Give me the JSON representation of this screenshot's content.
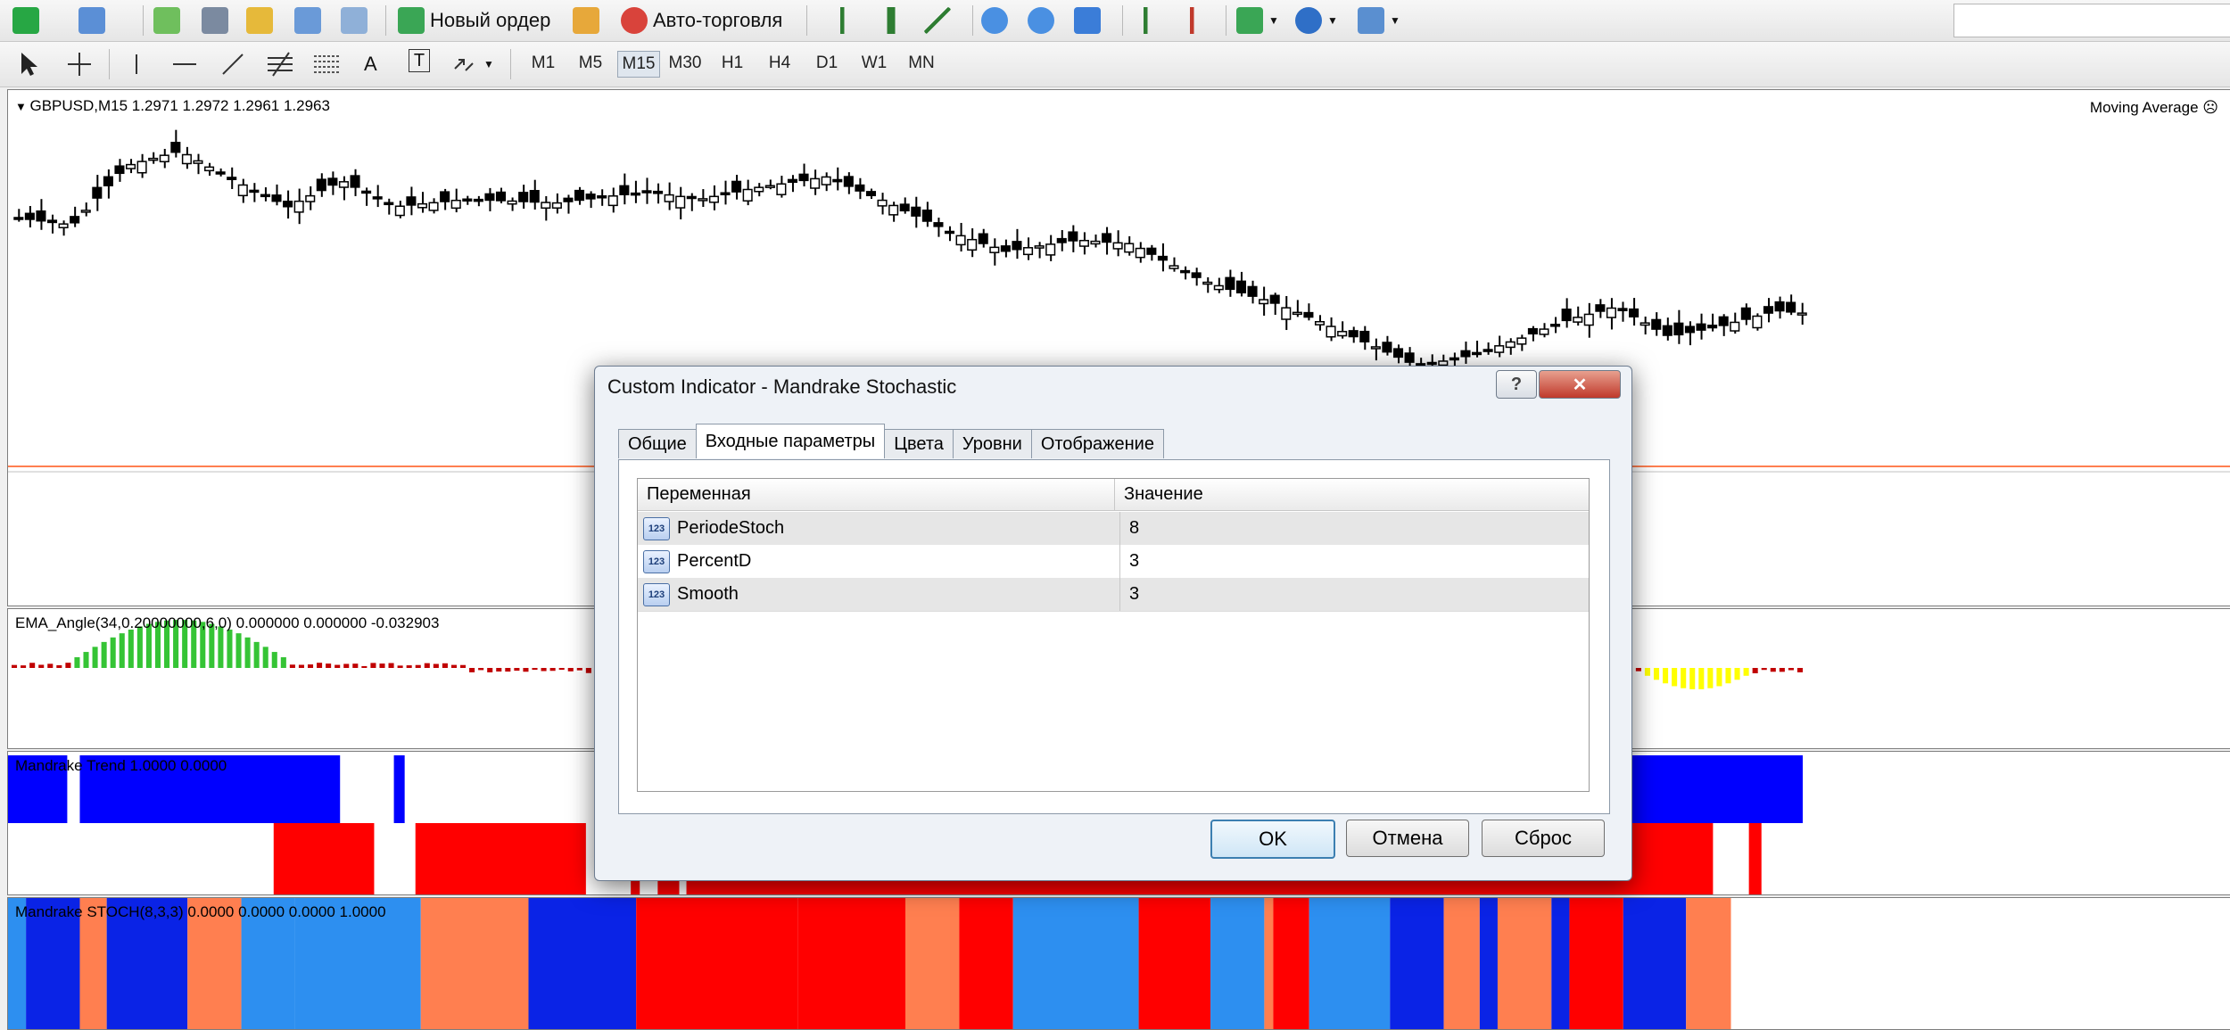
{
  "toolbar": {
    "new_order": "Новый ордер",
    "auto_trading": "Авто-торговля",
    "timeframes": [
      "M1",
      "M5",
      "M15",
      "M30",
      "H1",
      "H4",
      "D1",
      "W1",
      "MN"
    ],
    "active_timeframe": "M15",
    "draw_tools": [
      "cursor-icon",
      "crosshair-icon",
      "vertical-line-icon",
      "horizontal-line-icon",
      "trendline-icon",
      "fibonacci-icon",
      "fibo-fan-icon",
      "text-icon",
      "text-label-icon",
      "arrows-icon"
    ],
    "text_tool_label": "A",
    "text_label_tool": "T"
  },
  "main_chart": {
    "symbol_info": "GBPUSD,M15  1.2971 1.2972 1.2961 1.2963",
    "expert_label": "Moving Average"
  },
  "ema_pane": {
    "label": "EMA_Angle(34,0.20000000,6,0) 0.000000 0.000000 -0.032903"
  },
  "trend_pane": {
    "label": "Mandrake Trend 1.0000 0.0000"
  },
  "stoch_pane": {
    "label": "Mandrake STOCH(8,3,3) 0.0000 0.0000 0.0000 1.0000"
  },
  "dialog": {
    "title": "Custom Indicator - Mandrake Stochastic",
    "help_symbol": "?",
    "close_symbol": "✕",
    "tabs": [
      "Общие",
      "Входные параметры",
      "Цвета",
      "Уровни",
      "Отображение"
    ],
    "active_tab": "Входные параметры",
    "columns": [
      "Переменная",
      "Значение"
    ],
    "params": [
      {
        "name": "PeriodeStoch",
        "value": "8",
        "icon": "123"
      },
      {
        "name": "PercentD",
        "value": "3",
        "icon": "123"
      },
      {
        "name": "Smooth",
        "value": "3",
        "icon": "123"
      }
    ],
    "buttons": {
      "ok": "OK",
      "cancel": "Отмена",
      "reset": "Сброс"
    }
  },
  "colors": {
    "bull": "#000000",
    "price_line": "#ff7f50",
    "ema_green": "#35c435",
    "ema_red": "#c00000",
    "ema_yellow": "#ffff00",
    "trend_blue": "#0000ff",
    "trend_red": "#ff0000",
    "stoch_blue": "#0a23e6",
    "stoch_light": "#2d8ff0",
    "stoch_orange": "#ff7f50",
    "stoch_red": "#ff0000"
  }
}
